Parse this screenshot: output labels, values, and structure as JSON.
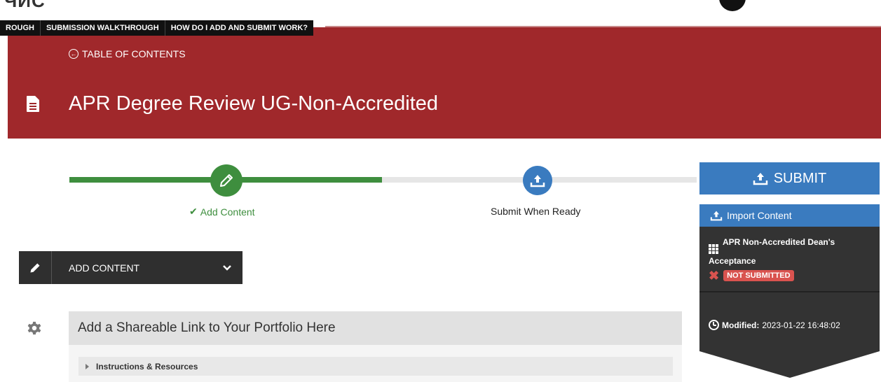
{
  "header": {
    "logo_fragment": "ЧИС",
    "help_links": [
      "ROUGH",
      "SUBMISSION WALKTHROUGH",
      "HOW DO I ADD AND SUBMIT WORK?"
    ]
  },
  "banner": {
    "toc_label": "TABLE OF CONTENTS",
    "page_title": "APR Degree Review UG-Non-Accredited",
    "color": "#a0282b"
  },
  "progress": {
    "step1_label": "Add Content",
    "step2_label": "Submit When Ready",
    "step1_color": "#3e8e3e",
    "step2_color": "#3a7bbf"
  },
  "submit": {
    "label": "SUBMIT"
  },
  "right_panel": {
    "import_label": "Import Content",
    "item_title": "APR Non-Accredited Dean's Acceptance",
    "status": "NOT SUBMITTED",
    "modified_label": "Modified:",
    "modified_value": "2023-01-22 16:48:02"
  },
  "add_content": {
    "label": "ADD CONTENT"
  },
  "section": {
    "title": "Add a Shareable Link to Your Portfolio Here",
    "instructions_label": "Instructions & Resources"
  }
}
